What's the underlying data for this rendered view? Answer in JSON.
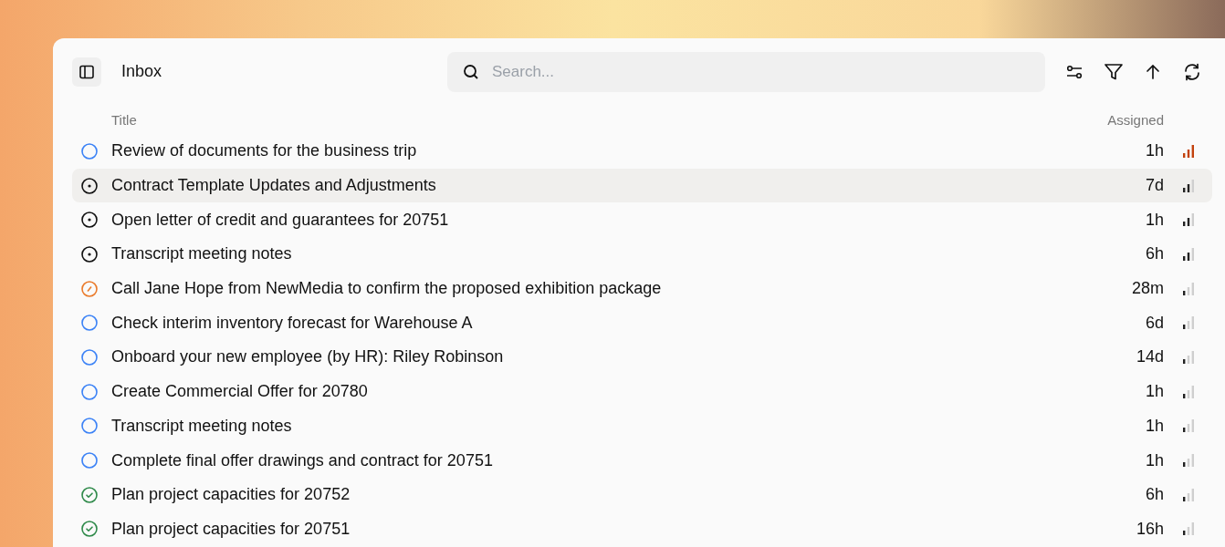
{
  "header": {
    "title": "Inbox"
  },
  "search": {
    "placeholder": "Search..."
  },
  "table": {
    "columns": [
      "Title",
      "Assigned"
    ],
    "rows": [
      {
        "status": {
          "kind": "todo"
        },
        "title": "Review of documents for the business trip",
        "assigned": "1h",
        "priority": {
          "kind": "urgent"
        },
        "selected": false
      },
      {
        "status": {
          "kind": "started"
        },
        "title": "Contract Template Updates and Adjustments",
        "assigned": "7d",
        "priority": {
          "kind": "medium"
        },
        "selected": true
      },
      {
        "status": {
          "kind": "started"
        },
        "title": "Open letter of credit and guarantees for 20751",
        "assigned": "1h",
        "priority": {
          "kind": "medium"
        },
        "selected": false
      },
      {
        "status": {
          "kind": "started"
        },
        "title": "Transcript meeting notes",
        "assigned": "6h",
        "priority": {
          "kind": "medium"
        },
        "selected": false
      },
      {
        "status": {
          "kind": "blocked"
        },
        "title": "Call Jane Hope from NewMedia to confirm the proposed exhibition package",
        "assigned": "28m",
        "priority": {
          "kind": "low"
        },
        "selected": false
      },
      {
        "status": {
          "kind": "todo"
        },
        "title": "Check interim inventory forecast for Warehouse A",
        "assigned": "6d",
        "priority": {
          "kind": "low"
        },
        "selected": false
      },
      {
        "status": {
          "kind": "todo"
        },
        "title": "Onboard your new employee (by HR): Riley Robinson",
        "assigned": "14d",
        "priority": {
          "kind": "low"
        },
        "selected": false
      },
      {
        "status": {
          "kind": "todo"
        },
        "title": "Create Commercial Offer for 20780",
        "assigned": "1h",
        "priority": {
          "kind": "low"
        },
        "selected": false
      },
      {
        "status": {
          "kind": "todo"
        },
        "title": "Transcript meeting notes",
        "assigned": "1h",
        "priority": {
          "kind": "low"
        },
        "selected": false
      },
      {
        "status": {
          "kind": "todo"
        },
        "title": "Complete final offer drawings and contract for 20751",
        "assigned": "1h",
        "priority": {
          "kind": "low"
        },
        "selected": false
      },
      {
        "status": {
          "kind": "done"
        },
        "title": "Plan project capacities for 20752",
        "assigned": "6h",
        "priority": {
          "kind": "low"
        },
        "selected": false
      },
      {
        "status": {
          "kind": "done"
        },
        "title": "Plan project capacities for 20751",
        "assigned": "16h",
        "priority": {
          "kind": "low"
        },
        "selected": false
      }
    ]
  }
}
